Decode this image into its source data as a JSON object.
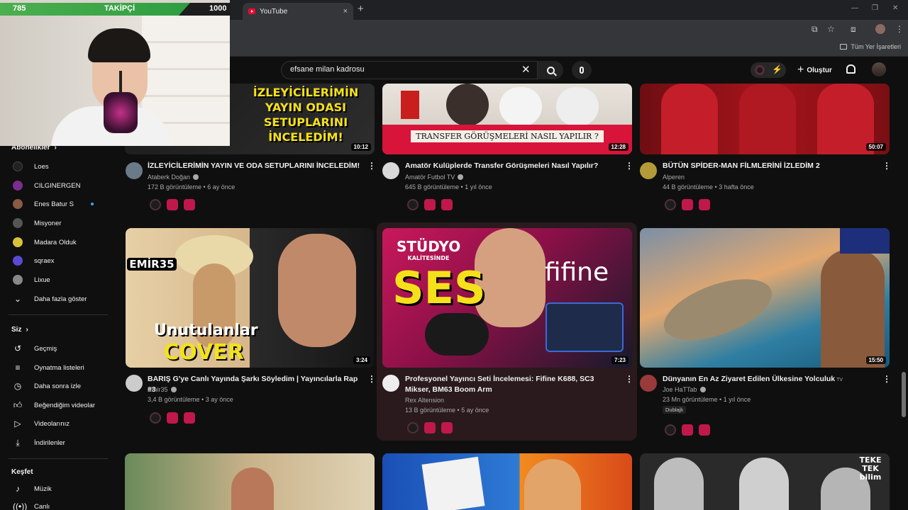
{
  "browser": {
    "tab_title": "YouTube",
    "new_tab": "+",
    "tab_close": "×",
    "bookmarks_all": "Tüm Yer İşaretleri"
  },
  "stream_overlay": {
    "followers_current": "785",
    "followers_label": "TAKİPÇİ",
    "followers_goal": "1000",
    "progress_fraction": 0.785
  },
  "header": {
    "search_value": "efsane milan kadrosu",
    "create_label": "Oluştur"
  },
  "sidebar": {
    "subscriptions_heading": "Abonelikler",
    "subscriptions": [
      {
        "label": "Loes",
        "color": "#222222"
      },
      {
        "label": "CILGINERGEN",
        "color": "#7b2d8f"
      },
      {
        "label": "Enes Batur S",
        "color": "#8a5a44",
        "live": true
      },
      {
        "label": "Misyoner",
        "color": "#555555"
      },
      {
        "label": "Madara Olduk",
        "color": "#d8c23a"
      },
      {
        "label": "sqraex",
        "color": "#5a4ad1"
      },
      {
        "label": "Lixue",
        "color": "#888888"
      }
    ],
    "show_more": "Daha fazla göster",
    "you_heading": "Siz",
    "you_items": [
      {
        "label": "Geçmiş",
        "icon": "history-icon"
      },
      {
        "label": "Oynatma listeleri",
        "icon": "playlists-icon"
      },
      {
        "label": "Daha sonra izle",
        "icon": "watch-later-icon"
      },
      {
        "label": "Beğendiğim videolar",
        "icon": "like-icon"
      },
      {
        "label": "Videolarınız",
        "icon": "your-videos-icon"
      },
      {
        "label": "İndirilenler",
        "icon": "download-icon"
      }
    ],
    "explore_heading": "Keşfet",
    "explore_items": [
      {
        "label": "Müzik",
        "icon": "music-icon"
      },
      {
        "label": "Canlı",
        "icon": "live-icon"
      }
    ]
  },
  "videos": [
    {
      "title": "İZLEYİCİLERİMİN YAYIN VE ODA SETUPLARINI İNCELEDİM!",
      "channel": "Ataberk Doğan",
      "verified": true,
      "meta": "172 B görüntüleme • 6 ay önce",
      "duration": "10:12",
      "thumb_text": "İZLEYİCİLERİMİN YAYIN ODASI SETUPLARINI İNCELEDİM!",
      "avatar_color": "#6a7a88"
    },
    {
      "title": "Amatör Kulüplerde Transfer Görüşmeleri Nasıl Yapılır?",
      "channel": "Amatör Futbol TV",
      "verified": true,
      "meta": "645 B görüntüleme • 1 yıl önce",
      "duration": "12:28",
      "thumb_text": "TRANSFER GÖRÜŞMELERİ NASIL YAPILIR ?",
      "avatar_color": "#d9d9d9"
    },
    {
      "title": "BÜTÜN SPİDER-MAN FİLMLERİNİ İZLEDİM 2",
      "channel": "Alperen",
      "verified": false,
      "meta": "44 B görüntüleme • 3 hafta önce",
      "duration": "50:07",
      "avatar_color": "#b59a3a"
    },
    {
      "title": "BARIŞ G'ye Canlı Yayında Şarkı Söyledim | Yayıncılarla Rap #3",
      "channel": "Emir35",
      "verified": true,
      "meta": "3,4 B görüntüleme • 3 ay önce",
      "duration": "3:24",
      "thumb_text_1": "EMİR35",
      "thumb_text_2": "Unutulanlar",
      "thumb_text_3": "COVER",
      "avatar_color": "#cccccc"
    },
    {
      "title": "Profesyonel Yayıncı Seti İncelemesi: Fifine K688, SC3 Mikser, BM63 Boom Arm",
      "channel": "Rex Altension",
      "verified": false,
      "meta": "13 B görüntüleme • 5 ay önce",
      "duration": "7:23",
      "thumb_text_1": "STÜDYO",
      "thumb_text_2": "KALİTESİNDE",
      "thumb_text_3": "SES",
      "thumb_text_4": "fifine",
      "avatar_color": "#eeeeee"
    },
    {
      "title": "Dünyanın En Az Ziyaret Edilen Ülkesine Yolculuk",
      "title_badge": "TV",
      "channel": "Joe HaTTab",
      "verified": true,
      "meta": "23 Mn görüntüleme • 1 yıl önce",
      "badge": "Dublajlı",
      "duration": "15:50",
      "avatar_color": "#9a3a3a"
    },
    {
      "thumb_text": "TEKE TEK bilim"
    }
  ],
  "colors": {
    "background": "#0f0f0f",
    "accent_red": "#ff0033",
    "follow_green": "#4caf50",
    "hover_card": "#2a1a1d"
  }
}
